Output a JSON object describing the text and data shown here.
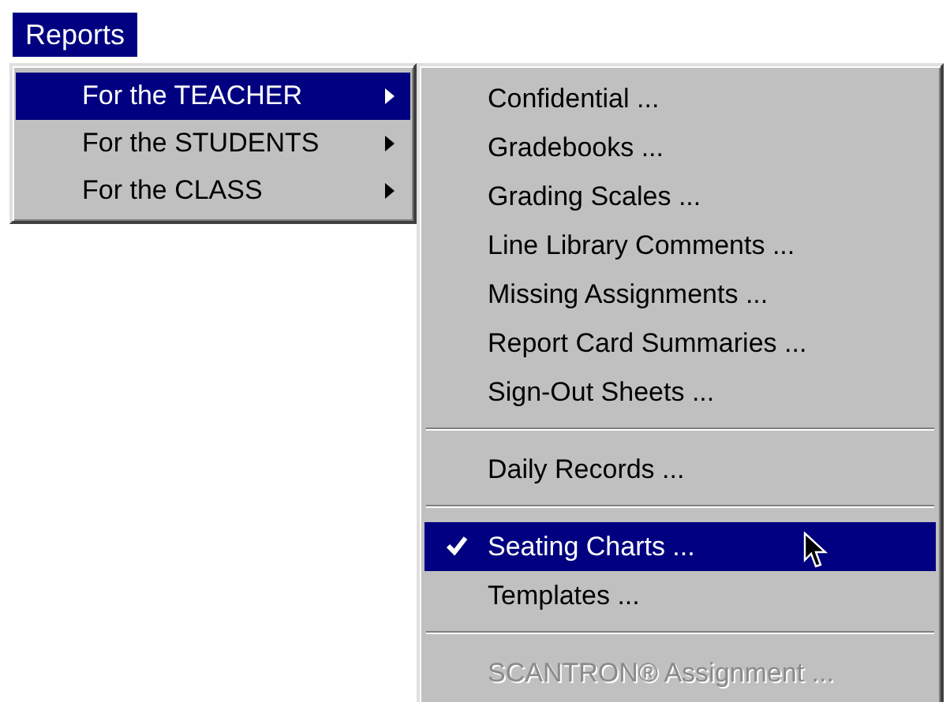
{
  "menu_bar": {
    "title": "Reports",
    "selected": true
  },
  "menu": [
    {
      "label": "For the TEACHER",
      "selected": true,
      "submenu": true
    },
    {
      "label": "For the STUDENTS",
      "selected": false,
      "submenu": true
    },
    {
      "label": "For the CLASS",
      "selected": false,
      "submenu": true
    }
  ],
  "submenu": [
    {
      "kind": "item",
      "label": "Confidential ...",
      "selected": false,
      "checked": false,
      "disabled": false
    },
    {
      "kind": "item",
      "label": "Gradebooks ...",
      "selected": false,
      "checked": false,
      "disabled": false
    },
    {
      "kind": "item",
      "label": "Grading Scales ...",
      "selected": false,
      "checked": false,
      "disabled": false
    },
    {
      "kind": "item",
      "label": "Line Library Comments ...",
      "selected": false,
      "checked": false,
      "disabled": false
    },
    {
      "kind": "item",
      "label": "Missing Assignments ...",
      "selected": false,
      "checked": false,
      "disabled": false
    },
    {
      "kind": "item",
      "label": "Report Card Summaries ...",
      "selected": false,
      "checked": false,
      "disabled": false
    },
    {
      "kind": "item",
      "label": "Sign-Out Sheets ...",
      "selected": false,
      "checked": false,
      "disabled": false
    },
    {
      "kind": "separator"
    },
    {
      "kind": "item",
      "label": "Daily Records ...",
      "selected": false,
      "checked": false,
      "disabled": false
    },
    {
      "kind": "separator"
    },
    {
      "kind": "item",
      "label": "Seating Charts ...",
      "selected": true,
      "checked": true,
      "disabled": false
    },
    {
      "kind": "item",
      "label": "Templates ...",
      "selected": false,
      "checked": false,
      "disabled": false
    },
    {
      "kind": "separator"
    },
    {
      "kind": "item",
      "label": "SCANTRON® Assignment ...",
      "selected": false,
      "checked": false,
      "disabled": true
    }
  ]
}
